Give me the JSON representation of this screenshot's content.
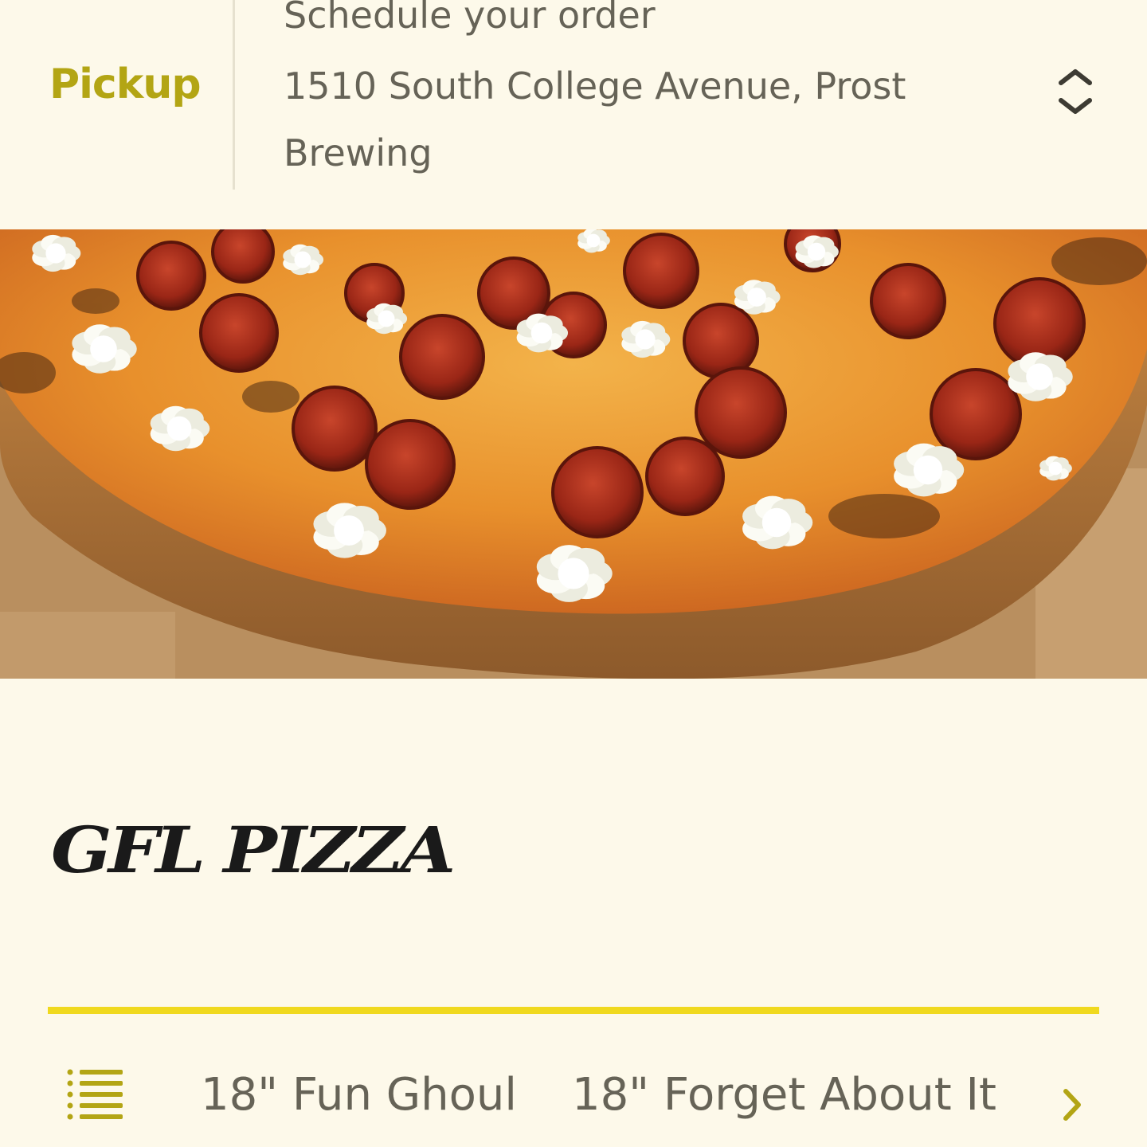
{
  "header": {
    "mode_label": "Pickup",
    "schedule_label": "Schedule your order",
    "address": "1510 South College Avenue, Prost Brewing",
    "selector_icon": "chevron-up-down-icon"
  },
  "hero": {
    "image_subject": "pepperoni pizza with ricotta dollops",
    "icon": "pizza-photo"
  },
  "brand": {
    "name": "GFL PIZZA"
  },
  "colors": {
    "background": "#fdf9ea",
    "accent_text": "#b3a514",
    "accent_line": "#f0d91e",
    "body_text": "#666357",
    "brand_text": "#1a1a1a"
  },
  "category_nav": {
    "menu_icon": "list-icon",
    "items": [
      {
        "label": "18\" Fun Ghoul"
      },
      {
        "label": "18\" Forget About It"
      }
    ],
    "next_icon": "chevron-right-icon"
  }
}
